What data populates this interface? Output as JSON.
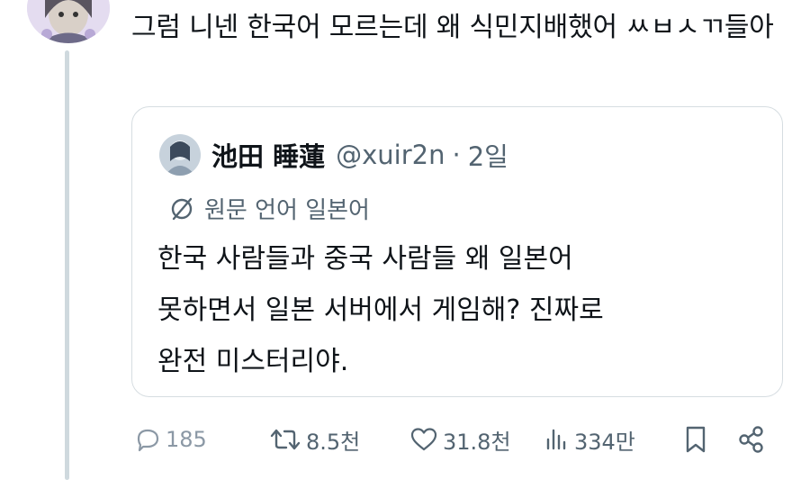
{
  "reply": {
    "text": "그럼 니넨 한국어 모르는데 왜 식민지배했어 ㅆㅂㅅㄲ들아"
  },
  "quoted_tweet": {
    "display_name": "池田 睡蓮",
    "handle": "@xuir2n",
    "separator": "·",
    "time": "2일",
    "language_note": "원문 언어 일본어",
    "body_lines": [
      "한국 사람들과 중국 사람들 왜 일본어",
      "못하면서 일본 서버에서 게임해? 진짜로",
      "완전 미스터리야."
    ]
  },
  "actions": {
    "replies": "185",
    "reposts": "8.5천",
    "likes": "31.8천",
    "views": "334만"
  },
  "icons": {
    "reply": "comment-icon",
    "repost": "repost-icon",
    "like": "heart-icon",
    "views": "bar-chart-icon",
    "bookmark": "bookmark-icon",
    "share": "share-icon",
    "translate": "translate-icon"
  }
}
